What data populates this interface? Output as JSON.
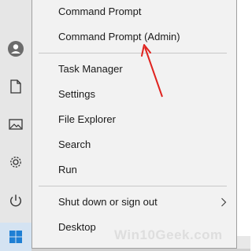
{
  "menu": {
    "items": [
      {
        "label": "Command Prompt"
      },
      {
        "label": "Command Prompt (Admin)"
      },
      {
        "label": "Task Manager"
      },
      {
        "label": "Settings"
      },
      {
        "label": "File Explorer"
      },
      {
        "label": "Search"
      },
      {
        "label": "Run"
      },
      {
        "label": "Shut down or sign out"
      },
      {
        "label": "Desktop"
      }
    ]
  },
  "rail": {
    "icons": [
      "user-icon",
      "document-icon",
      "pictures-icon",
      "settings-gear-icon",
      "power-icon"
    ]
  },
  "start": {
    "icon": "windows-logo-icon",
    "color": "#1e7fd4"
  },
  "annotation": {
    "color": "#e0231f"
  },
  "watermark": {
    "text": "Win10Geek.com"
  }
}
